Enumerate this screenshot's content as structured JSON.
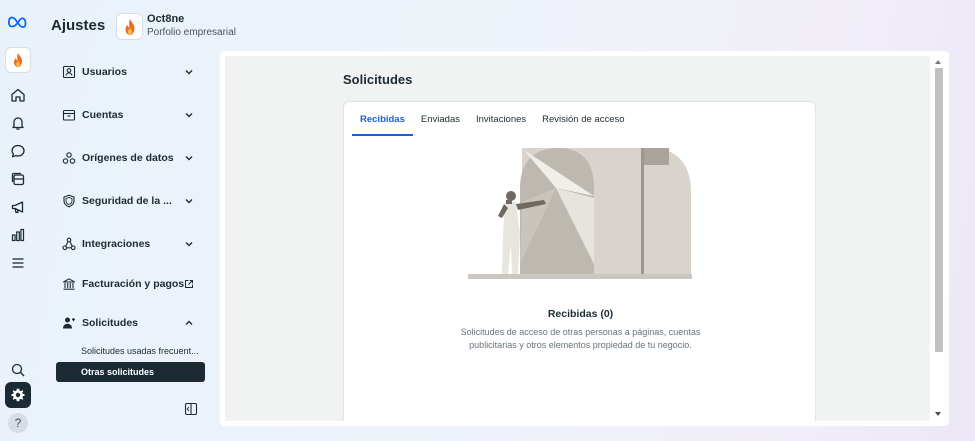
{
  "header": {
    "title": "Ajustes",
    "portfolio_name": "Oct8ne",
    "portfolio_type": "Porfolio empresarial"
  },
  "menu": {
    "items": [
      {
        "label": "Usuarios",
        "icon": "users-icon",
        "expanded": false
      },
      {
        "label": "Cuentas",
        "icon": "accounts-icon",
        "expanded": false
      },
      {
        "label": "Orígenes de datos",
        "icon": "data-sources-icon",
        "expanded": false
      },
      {
        "label": "Seguridad de la ...",
        "icon": "shield-icon",
        "expanded": false
      },
      {
        "label": "Integraciones",
        "icon": "integrations-icon",
        "expanded": false
      },
      {
        "label": "Facturación y pagos",
        "icon": "bank-icon",
        "external": true
      },
      {
        "label": "Solicitudes",
        "icon": "requests-icon",
        "expanded": true
      }
    ],
    "sub_items": [
      {
        "label": "Solicitudes usadas frecuent...",
        "active": false
      },
      {
        "label": "Otras solicitudes",
        "active": true
      }
    ]
  },
  "main": {
    "section_title": "Solicitudes",
    "tabs": [
      {
        "label": "Recibidas",
        "active": true
      },
      {
        "label": "Enviadas",
        "active": false
      },
      {
        "label": "Invitaciones",
        "active": false
      },
      {
        "label": "Revisión de acceso",
        "active": false
      }
    ],
    "empty_title": "Recibidas (0)",
    "empty_desc": "Solicitudes de acceso de otras personas a páginas, cuentas publicitarias y otros elementos propiedad de tu negocio."
  },
  "colors": {
    "accent": "#1b61d1",
    "dark": "#1c2b33",
    "brand_flame": "#f26b1d"
  }
}
